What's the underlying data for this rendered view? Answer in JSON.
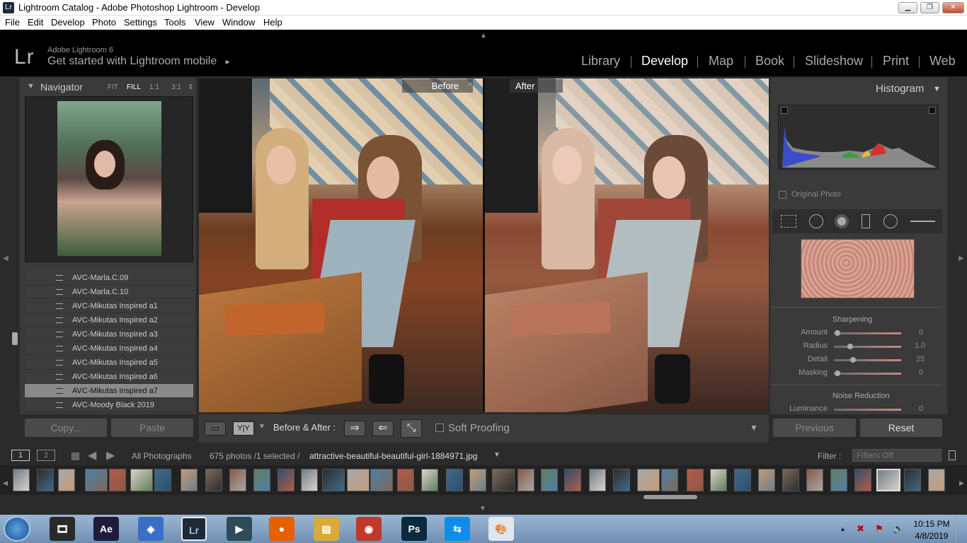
{
  "window": {
    "app_icon": "Lr",
    "title": "Lightroom Catalog - Adobe Photoshop Lightroom - Develop",
    "controls": {
      "minimize": "▁",
      "restore": "❐",
      "close": "✕"
    }
  },
  "menu": [
    "File",
    "Edit",
    "Develop",
    "Photo",
    "Settings",
    "Tools",
    "View",
    "Window",
    "Help"
  ],
  "header": {
    "logo": "Lr",
    "brand_line1": "Adobe Lightroom 6",
    "brand_line2": "Get started with Lightroom mobile",
    "brand_arrow": "▸",
    "modules": [
      "Library",
      "Develop",
      "Map",
      "Book",
      "Slideshow",
      "Print",
      "Web"
    ],
    "active_module": "Develop"
  },
  "navigator": {
    "title": "Navigator",
    "zoom_options": [
      "FIT",
      "FILL",
      "1:1",
      "3:1"
    ],
    "active_zoom": "FILL"
  },
  "presets": [
    {
      "label": "AVC-Marla.C.09",
      "selected": false
    },
    {
      "label": "AVC-Marla.C.10",
      "selected": false
    },
    {
      "label": "AVC-Mikutas Inspired a1",
      "selected": false
    },
    {
      "label": "AVC-Mikutas Inspired a2",
      "selected": false
    },
    {
      "label": "AVC-Mikutas Inspired a3",
      "selected": false
    },
    {
      "label": "AVC-Mikutas Inspired a4",
      "selected": false
    },
    {
      "label": "AVC-Mikutas Inspired a5",
      "selected": false
    },
    {
      "label": "AVC-Mikutas Inspired a6",
      "selected": false
    },
    {
      "label": "AVC-Mikutas Inspired a7",
      "selected": true
    },
    {
      "label": "AVC-Moody Black 2019",
      "selected": false
    }
  ],
  "left_buttons": {
    "copy": "Copy...",
    "paste": "Paste"
  },
  "compare": {
    "before": "Before",
    "after": "After"
  },
  "toolbar": {
    "view_single": "▭",
    "view_yy": "Y|Y",
    "before_after_label": "Before & After :",
    "soft_proofing": "Soft Proofing"
  },
  "histogram": {
    "title": "Histogram",
    "original_photo": "Original Photo"
  },
  "sharpening": {
    "title": "Sharpening",
    "sliders": [
      {
        "label": "Amount",
        "value": "0",
        "pos": 0.0
      },
      {
        "label": "Radius",
        "value": "1.0",
        "pos": 0.2
      },
      {
        "label": "Detail",
        "value": "25",
        "pos": 0.25
      },
      {
        "label": "Masking",
        "value": "0",
        "pos": 0.0
      }
    ]
  },
  "noise_reduction": {
    "title": "Noise Reduction",
    "luminance_label": "Luminance",
    "luminance_value": "0"
  },
  "right_buttons": {
    "previous": "Previous",
    "reset": "Reset"
  },
  "filmstrip_bar": {
    "page1": "1",
    "page2": "2",
    "source": "All Photographs",
    "count": "675 photos /1 selected /",
    "filename": "attractive-beautiful-beautiful-girl-1884971.jpg",
    "filter_label": "Filter :",
    "filter_value": "Filters Off"
  },
  "taskbar": {
    "apps": [
      {
        "name": "windows-media-icon",
        "glyph": "🎞",
        "color": "#2a2a2a"
      },
      {
        "name": "after-effects-icon",
        "glyph": "Ae",
        "color": "#1f1b3a"
      },
      {
        "name": "network-app-icon",
        "glyph": "◈",
        "color": "#3a6fc7"
      },
      {
        "name": "lightroom-icon",
        "glyph": "Lr",
        "color": "#1e2a36"
      },
      {
        "name": "filmora-icon",
        "glyph": "▶",
        "color": "#2d4c57"
      },
      {
        "name": "firefox-icon",
        "glyph": "●",
        "color": "#e66000"
      },
      {
        "name": "explorer-icon",
        "glyph": "▤",
        "color": "#d9a93a"
      },
      {
        "name": "camera-app-icon",
        "glyph": "◉",
        "color": "#c0392b"
      },
      {
        "name": "photoshop-icon",
        "glyph": "Ps",
        "color": "#0a2a3e"
      },
      {
        "name": "teamviewer-icon",
        "glyph": "⇆",
        "color": "#0e8ee9"
      },
      {
        "name": "paint-icon",
        "glyph": "🎨",
        "color": "#dfe6ee"
      }
    ],
    "time": "10:15 PM",
    "date": "4/8/2019"
  }
}
